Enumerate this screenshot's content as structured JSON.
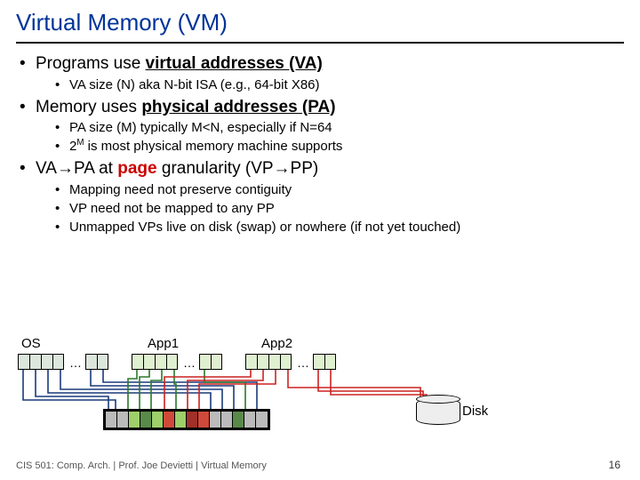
{
  "title": "Virtual Memory (VM)",
  "bullets": {
    "b1": {
      "pre": "Programs use ",
      "bold": "virtual addresses (VA)"
    },
    "b1s1": "VA size (N) aka N-bit ISA (e.g., 64-bit X86)",
    "b2": {
      "pre": "Memory uses ",
      "bold": "physical addresses (PA)"
    },
    "b2s1": "PA size (M) typically M<N, especially if N=64",
    "b2s2_pre": "2",
    "b2s2_sup": "M",
    "b2s2_post": " is most physical memory machine supports",
    "b3_pre": "VA",
    "b3_arrow1": "→",
    "b3_mid1": "PA at ",
    "b3_red": "page",
    "b3_mid2": " granularity (VP",
    "b3_arrow2": "→",
    "b3_end": "PP)",
    "b3s1": "Mapping need not preserve contiguity",
    "b3s2": "VP need not be mapped to any PP",
    "b3s3": "Unmapped VPs live on disk (swap) or nowhere (if not yet touched)"
  },
  "figure": {
    "os_label": "OS",
    "app1_label": "App1",
    "app2_label": "App2",
    "dots": "…",
    "disk_label": "Disk"
  },
  "footer": "CIS 501: Comp. Arch.  |  Prof. Joe Devietti  |  Virtual Memory",
  "page": "16"
}
